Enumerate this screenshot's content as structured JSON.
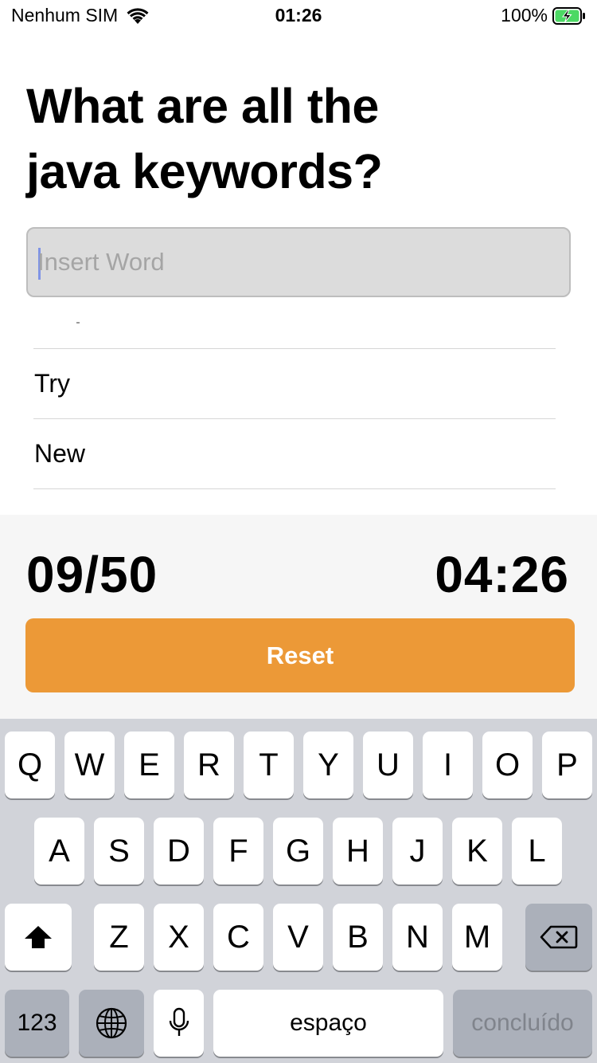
{
  "status_bar": {
    "carrier": "Nenhum SIM",
    "time": "01:26",
    "battery": "100%"
  },
  "question": {
    "line1": "What are all the",
    "line2": "java keywords?"
  },
  "input": {
    "placeholder": "Insert Word",
    "value": ""
  },
  "answers": [
    "Try",
    "New"
  ],
  "score": {
    "found": "09/50",
    "timer": "04:26"
  },
  "reset_label": "Reset",
  "keyboard": {
    "row1": [
      "Q",
      "W",
      "E",
      "R",
      "T",
      "Y",
      "U",
      "I",
      "O",
      "P"
    ],
    "row2": [
      "A",
      "S",
      "D",
      "F",
      "G",
      "H",
      "J",
      "K",
      "L"
    ],
    "row3": [
      "Z",
      "X",
      "C",
      "V",
      "B",
      "N",
      "M"
    ],
    "numbers_label": "123",
    "space_label": "espaço",
    "done_label": "concluído"
  },
  "colors": {
    "accent": "#ec9937",
    "input_bg": "#dcdcdc",
    "panel_bg": "#f6f6f6",
    "keyboard_bg": "#d1d3d9",
    "battery_green": "#4cd964"
  },
  "icons": {
    "wifi": "wifi-icon",
    "battery": "battery-charging-icon",
    "shift": "shift-icon",
    "backspace": "backspace-icon",
    "globe": "globe-icon",
    "mic": "microphone-icon"
  }
}
